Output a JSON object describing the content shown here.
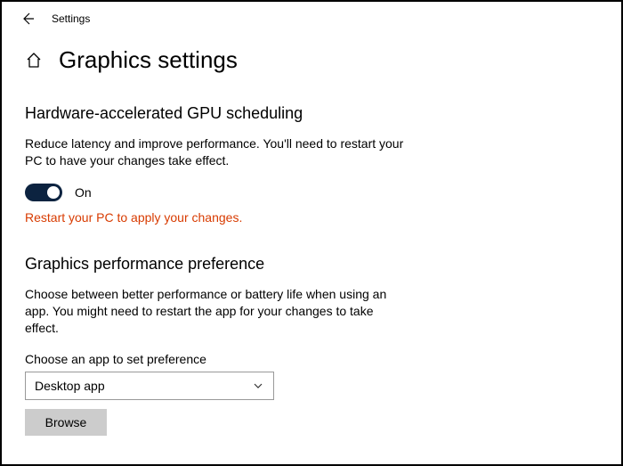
{
  "topbar": {
    "title": "Settings"
  },
  "page": {
    "title": "Graphics settings"
  },
  "gpu_scheduling": {
    "heading": "Hardware-accelerated GPU scheduling",
    "description": "Reduce latency and improve performance. You'll need to restart your PC to have your changes take effect.",
    "toggle_state": "On",
    "warning": "Restart your PC to apply your changes."
  },
  "perf_pref": {
    "heading": "Graphics performance preference",
    "description": "Choose between better performance or battery life when using an app. You might need to restart the app for your changes to take effect.",
    "field_label": "Choose an app to set preference",
    "select_value": "Desktop app",
    "browse_label": "Browse"
  }
}
